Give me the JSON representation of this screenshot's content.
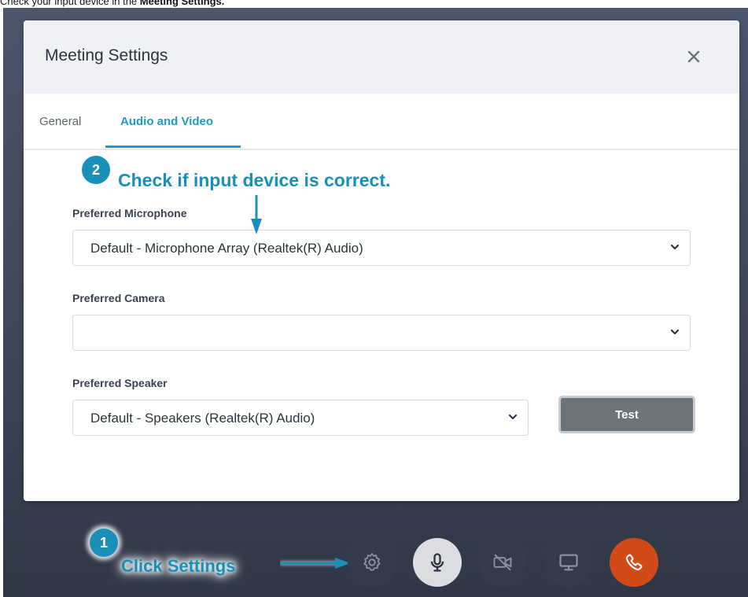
{
  "caption": {
    "prefix": "Check your input device in the ",
    "bold": "Meeting Settings."
  },
  "modal": {
    "title": "Meeting Settings",
    "close_icon": "close-icon"
  },
  "tabs": [
    {
      "label": "General",
      "active": false
    },
    {
      "label": "Audio and Video",
      "active": true
    }
  ],
  "fields": {
    "microphone": {
      "label": "Preferred Microphone",
      "value": "Default - Microphone Array (Realtek(R) Audio)"
    },
    "camera": {
      "label": "Preferred Camera",
      "value": ""
    },
    "speaker": {
      "label": "Preferred Speaker",
      "value": "Default - Speakers (Realtek(R) Audio)"
    }
  },
  "test_button": {
    "label": "Test"
  },
  "annotations": {
    "step1": {
      "number": "1",
      "text": "Click Settings"
    },
    "step2": {
      "number": "2",
      "text": "Check if input device is correct."
    }
  },
  "toolbar": [
    {
      "icon": "gear-icon",
      "bg": "#333a4a"
    },
    {
      "icon": "microphone-icon",
      "bg": "#dcdde0"
    },
    {
      "icon": "camera-off-icon",
      "bg": "#333a4a"
    },
    {
      "icon": "monitor-icon",
      "bg": "#333a4a"
    },
    {
      "icon": "phone-hangup-icon",
      "bg": "#d24a17"
    }
  ],
  "colors": {
    "accent": "#1f9bc6",
    "annotation": "#1a8fb8",
    "hangup": "#d24a17"
  }
}
